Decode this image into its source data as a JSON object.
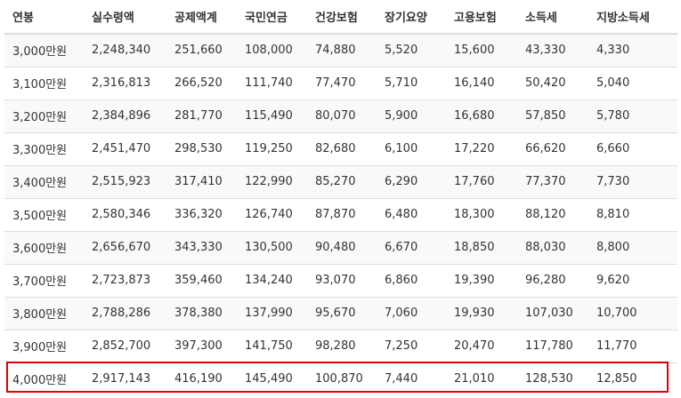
{
  "table": {
    "headers": [
      "연봉",
      "실수령액",
      "공제액계",
      "국민연금",
      "건강보험",
      "장기요양",
      "고용보험",
      "소득세",
      "지방소득세"
    ],
    "rows": [
      [
        "3,000만원",
        "2,248,340",
        "251,660",
        "108,000",
        "74,880",
        "5,520",
        "15,600",
        "43,330",
        "4,330"
      ],
      [
        "3,100만원",
        "2,316,813",
        "266,520",
        "111,740",
        "77,470",
        "5,710",
        "16,140",
        "50,420",
        "5,040"
      ],
      [
        "3,200만원",
        "2,384,896",
        "281,770",
        "115,490",
        "80,070",
        "5,900",
        "16,680",
        "57,850",
        "5,780"
      ],
      [
        "3,300만원",
        "2,451,470",
        "298,530",
        "119,250",
        "82,680",
        "6,100",
        "17,220",
        "66,620",
        "6,660"
      ],
      [
        "3,400만원",
        "2,515,923",
        "317,410",
        "122,990",
        "85,270",
        "6,290",
        "17,760",
        "77,370",
        "7,730"
      ],
      [
        "3,500만원",
        "2,580,346",
        "336,320",
        "126,740",
        "87,870",
        "6,480",
        "18,300",
        "88,120",
        "8,810"
      ],
      [
        "3,600만원",
        "2,656,670",
        "343,330",
        "130,500",
        "90,480",
        "6,670",
        "18,850",
        "88,030",
        "8,800"
      ],
      [
        "3,700만원",
        "2,723,873",
        "359,460",
        "134,240",
        "93,070",
        "6,860",
        "19,390",
        "96,280",
        "9,620"
      ],
      [
        "3,800만원",
        "2,788,286",
        "378,380",
        "137,990",
        "95,670",
        "7,060",
        "19,930",
        "107,030",
        "10,700"
      ],
      [
        "3,900만원",
        "2,852,700",
        "397,300",
        "141,750",
        "98,280",
        "7,250",
        "20,470",
        "117,780",
        "11,770"
      ],
      [
        "4,000만원",
        "2,917,143",
        "416,190",
        "145,490",
        "100,870",
        "7,440",
        "21,010",
        "128,530",
        "12,850"
      ]
    ]
  },
  "colors": {
    "highlight_border": "#e00000",
    "row_stripe": "#f9f9f9",
    "grid_line": "#dddddd",
    "text": "#333333"
  }
}
